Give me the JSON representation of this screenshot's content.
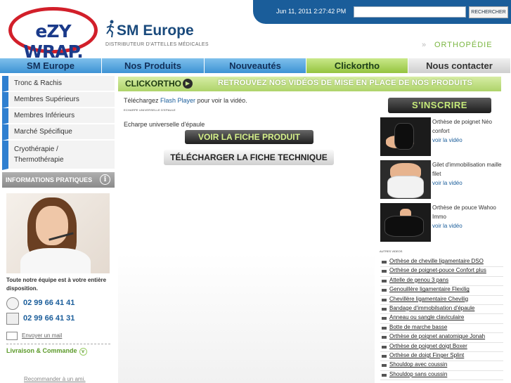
{
  "header": {
    "date": "Jun 11, 2011 2:27:42 PM",
    "search_placeholder": "",
    "search_button": "RECHERCHER",
    "logo": "eZY WRAP.",
    "brand_title": "SM Europe",
    "brand_subtitle": "DISTRIBUTEUR D'ATTELLES MÉDICALES",
    "section": "ORTHOPÉDIE"
  },
  "nav": [
    {
      "label": "SM Europe"
    },
    {
      "label": "Nos Produits"
    },
    {
      "label": "Nouveautés"
    },
    {
      "label": "Clickortho"
    },
    {
      "label": "Nous contacter"
    }
  ],
  "sidebar": {
    "items": [
      {
        "label": "Tronc & Rachis"
      },
      {
        "label": "Membres Supérieurs"
      },
      {
        "label": "Membres Inférieurs"
      },
      {
        "label": "Marché Spécifique"
      },
      {
        "label": "Cryothérapie / Thermothérapie"
      }
    ],
    "info_title": "INFORMATIONS PRATIQUES",
    "info_text": "Toute notre équipe est à votre entière disposition.",
    "phone": "02 99 66 41 41",
    "fax": "02 99 66 41 31",
    "mail_link": "Envoyer un mail",
    "livraison": "Livraison & Commande",
    "recommend": "Recommander à un ami."
  },
  "main": {
    "banner_title": "CLICKORTHO",
    "banner_tagline": "RETROUVEZ NOS VIDÉOS DE MISE EN PLACE DE NOS PRODUITS",
    "flash_prefix": "Téléchargez ",
    "flash_link": "Flash Player",
    "flash_suffix": " pour voir la vidéo.",
    "tiny_title": "ECHARPE UNIVERSELLE D'EPAULE",
    "product_name": "Echarpe universelle d'épaule",
    "btn_fiche": "VOIR LA FICHE PRODUIT",
    "btn_tech": "TÉLÉCHARGER LA FICHE TECHNIQUE"
  },
  "right": {
    "subscribe": "S'INSCRIRE",
    "videos": [
      {
        "name": "Orthèse de poignet Néo confort",
        "link": "voir la vidéo"
      },
      {
        "name": "Gilet d'immobilisation maille filet",
        "link": "voir la vidéo"
      },
      {
        "name": "Orthèse de pouce Wahoo Immo",
        "link": "voir la vidéo"
      }
    ],
    "autres_title": "AUTRES VIDEOS",
    "autres": [
      "Orthèse de cheville ligamentaire DSO",
      "Orthèse de poignet-pouce Confort plus",
      "Attelle de genou 3 pans",
      "Genouillère ligamentaire Flexilig",
      "Chevillère ligamentaire Chevilig",
      "Bandage d'immobilsation d'épaule",
      "Anneau ou sangle claviculaire",
      "Botte de marche basse",
      "Orthèse de poignet anatomique Jonah",
      "Orthèse de poignet doigt Boxer",
      "Orthèse de doigt Finger Splint",
      "Shouldop avec coussin",
      "Shouldop sans coussin"
    ]
  }
}
